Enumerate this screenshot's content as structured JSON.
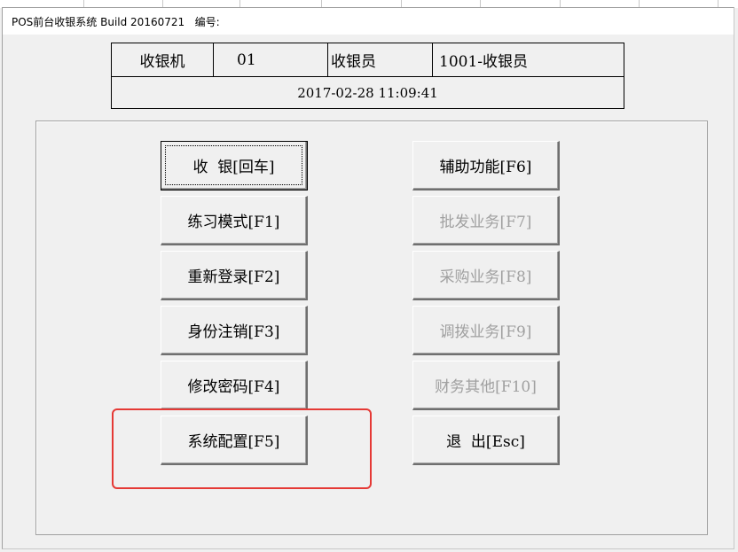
{
  "window": {
    "title": "POS前台收银系统 Build 20160721   编号:"
  },
  "info": {
    "machine_label": "收银机",
    "machine_value": "01",
    "cashier_label": "收银员",
    "cashier_value": "1001-收银员",
    "datetime": "2017-02-28 11:09:41"
  },
  "left_buttons": [
    {
      "label": "收  银[回车]",
      "enabled": true
    },
    {
      "label": "练习模式[F1]",
      "enabled": true
    },
    {
      "label": "重新登录[F2]",
      "enabled": true
    },
    {
      "label": "身份注销[F3]",
      "enabled": true
    },
    {
      "label": "修改密码[F4]",
      "enabled": true
    },
    {
      "label": "系统配置[F5]",
      "enabled": true
    }
  ],
  "right_buttons": [
    {
      "label": "辅助功能[F6]",
      "enabled": true
    },
    {
      "label": "批发业务[F7]",
      "enabled": false
    },
    {
      "label": "采购业务[F8]",
      "enabled": false
    },
    {
      "label": "调拨业务[F9]",
      "enabled": false
    },
    {
      "label": "财务其他[F10]",
      "enabled": false
    },
    {
      "label": "退  出[Esc]",
      "enabled": true
    }
  ],
  "colors": {
    "highlight": "#e53935",
    "disabled_text": "#a0a0a0"
  }
}
